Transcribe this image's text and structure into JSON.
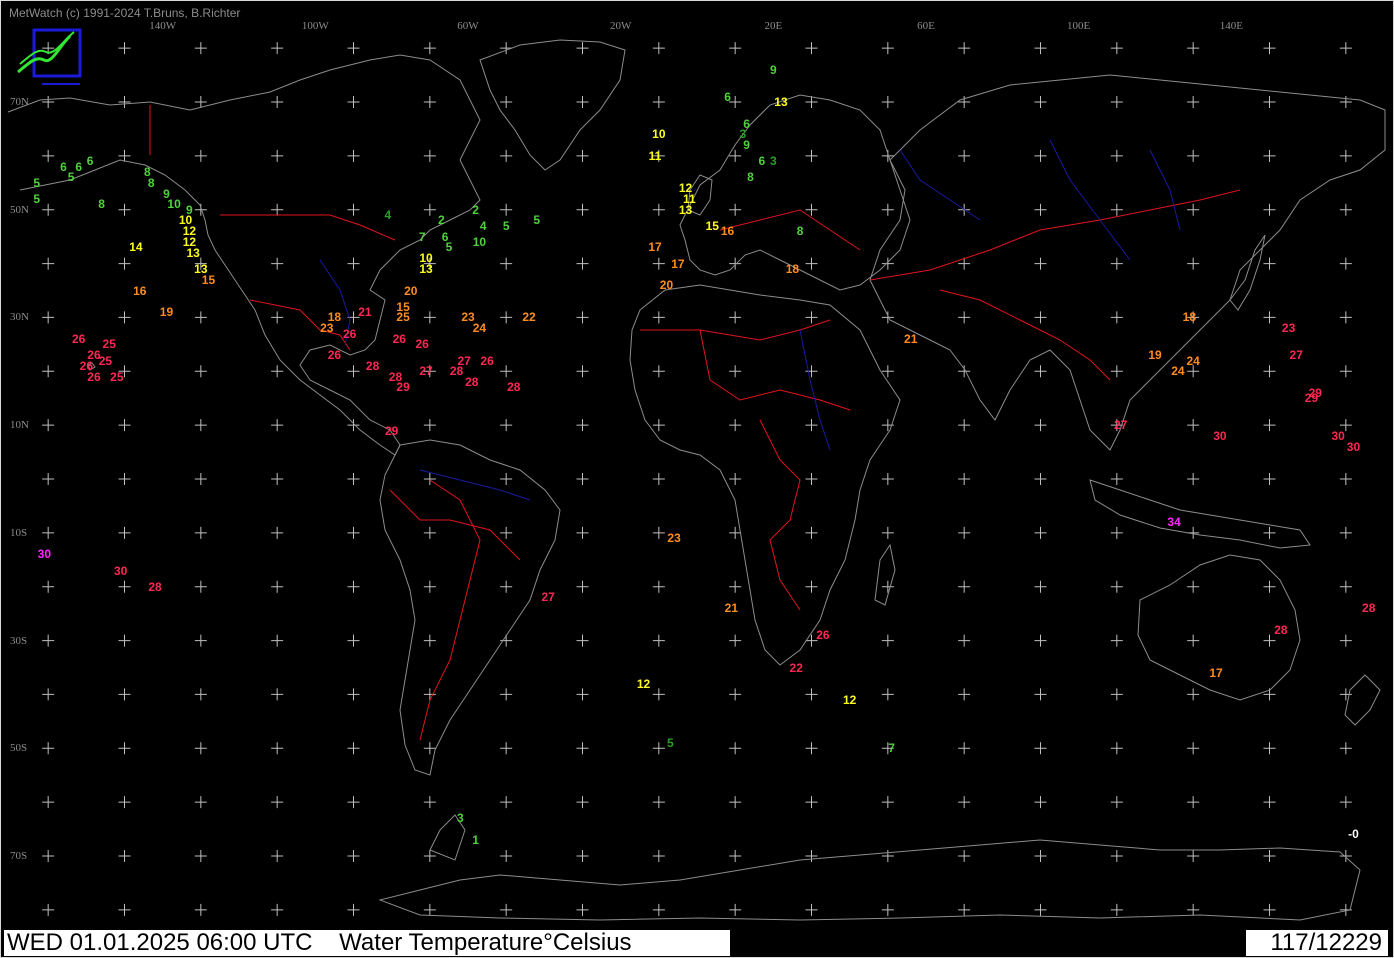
{
  "header": {
    "copyright": "MetWatch  (c) 1991-2024 T.Bruns, B.Richter"
  },
  "footer": {
    "datetime": "WED 01.01.2025 06:00 UTC",
    "title": "Water Temperature°Celsius",
    "count": "117/12229"
  },
  "colors": {
    "background": "#000000",
    "coastline": "#8c8c8c",
    "borders": "#e0141e",
    "rivers": "#1a1aa0",
    "grid": "#bfbfbf",
    "green": "#50d23c",
    "dark_green": "#2aa02a",
    "yellow": "#ffff1e",
    "orange": "#ff8c1e",
    "red": "#ff2850",
    "magenta": "#ff28ff",
    "white": "#ffffff"
  },
  "axes": {
    "lon_labels": [
      {
        "text": "140W",
        "lon": -140
      },
      {
        "text": "100W",
        "lon": -100
      },
      {
        "text": "60W",
        "lon": -60
      },
      {
        "text": "20W",
        "lon": -20
      },
      {
        "text": "20E",
        "lon": 20
      },
      {
        "text": "60E",
        "lon": 60
      },
      {
        "text": "100E",
        "lon": 100
      },
      {
        "text": "140E",
        "lon": 140
      }
    ],
    "lat_labels": [
      {
        "text": "70N",
        "lat": 70
      },
      {
        "text": "50N",
        "lat": 50
      },
      {
        "text": "30N",
        "lat": 30
      },
      {
        "text": "10N",
        "lat": 10
      },
      {
        "text": "10S",
        "lat": -10
      },
      {
        "text": "30S",
        "lat": -30
      },
      {
        "text": "50S",
        "lat": -50
      },
      {
        "text": "70S",
        "lat": -70
      }
    ],
    "lon_range": [
      -180,
      180
    ],
    "lat_range": [
      85,
      -90
    ],
    "grid_step_lon": 10,
    "grid_step_lat": 10
  },
  "observations": [
    {
      "v": "5",
      "lon": -173,
      "lat": 55,
      "c": "green"
    },
    {
      "v": "5",
      "lon": -173,
      "lat": 52,
      "c": "green"
    },
    {
      "v": "6",
      "lon": -166,
      "lat": 58,
      "c": "green"
    },
    {
      "v": "6",
      "lon": -162,
      "lat": 58,
      "c": "green"
    },
    {
      "v": "6",
      "lon": -159,
      "lat": 59,
      "c": "green"
    },
    {
      "v": "5",
      "lon": -164,
      "lat": 56,
      "c": "green"
    },
    {
      "v": "8",
      "lon": -156,
      "lat": 51,
      "c": "green"
    },
    {
      "v": "8",
      "lon": -144,
      "lat": 57,
      "c": "green"
    },
    {
      "v": "8",
      "lon": -143,
      "lat": 55,
      "c": "green"
    },
    {
      "v": "9",
      "lon": -139,
      "lat": 53,
      "c": "green"
    },
    {
      "v": "10",
      "lon": -137,
      "lat": 51,
      "c": "green"
    },
    {
      "v": "9",
      "lon": -133,
      "lat": 50,
      "c": "green"
    },
    {
      "v": "10",
      "lon": -134,
      "lat": 48,
      "c": "yellow"
    },
    {
      "v": "12",
      "lon": -133,
      "lat": 46,
      "c": "yellow"
    },
    {
      "v": "12",
      "lon": -133,
      "lat": 44,
      "c": "yellow"
    },
    {
      "v": "14",
      "lon": -147,
      "lat": 43,
      "c": "yellow"
    },
    {
      "v": "13",
      "lon": -132,
      "lat": 42,
      "c": "yellow"
    },
    {
      "v": "13",
      "lon": -130,
      "lat": 39,
      "c": "yellow"
    },
    {
      "v": "15",
      "lon": -128,
      "lat": 37,
      "c": "orange"
    },
    {
      "v": "16",
      "lon": -146,
      "lat": 35,
      "c": "orange"
    },
    {
      "v": "19",
      "lon": -139,
      "lat": 31,
      "c": "orange"
    },
    {
      "v": "4",
      "lon": -81,
      "lat": 49,
      "c": "dark_green"
    },
    {
      "v": "2",
      "lon": -67,
      "lat": 48,
      "c": "green"
    },
    {
      "v": "2",
      "lon": -58,
      "lat": 50,
      "c": "green"
    },
    {
      "v": "4",
      "lon": -56,
      "lat": 47,
      "c": "green"
    },
    {
      "v": "5",
      "lon": -50,
      "lat": 47,
      "c": "green"
    },
    {
      "v": "5",
      "lon": -42,
      "lat": 48,
      "c": "green"
    },
    {
      "v": "7",
      "lon": -72,
      "lat": 45,
      "c": "green"
    },
    {
      "v": "6",
      "lon": -66,
      "lat": 45,
      "c": "green"
    },
    {
      "v": "5",
      "lon": -65,
      "lat": 43,
      "c": "green"
    },
    {
      "v": "10",
      "lon": -57,
      "lat": 44,
      "c": "green"
    },
    {
      "v": "10",
      "lon": -71,
      "lat": 41,
      "c": "yellow"
    },
    {
      "v": "13",
      "lon": -71,
      "lat": 39,
      "c": "yellow"
    },
    {
      "v": "20",
      "lon": -75,
      "lat": 35,
      "c": "orange"
    },
    {
      "v": "15",
      "lon": -77,
      "lat": 32,
      "c": "orange"
    },
    {
      "v": "25",
      "lon": -77,
      "lat": 30,
      "c": "orange"
    },
    {
      "v": "18",
      "lon": -95,
      "lat": 30,
      "c": "orange"
    },
    {
      "v": "21",
      "lon": -87,
      "lat": 31,
      "c": "red"
    },
    {
      "v": "23",
      "lon": -97,
      "lat": 28,
      "c": "orange"
    },
    {
      "v": "26",
      "lon": -91,
      "lat": 27,
      "c": "red"
    },
    {
      "v": "26",
      "lon": -78,
      "lat": 26,
      "c": "red"
    },
    {
      "v": "23",
      "lon": -60,
      "lat": 30,
      "c": "orange"
    },
    {
      "v": "24",
      "lon": -57,
      "lat": 28,
      "c": "orange"
    },
    {
      "v": "22",
      "lon": -44,
      "lat": 30,
      "c": "orange"
    },
    {
      "v": "26",
      "lon": -95,
      "lat": 23,
      "c": "red"
    },
    {
      "v": "26",
      "lon": -72,
      "lat": 25,
      "c": "red"
    },
    {
      "v": "28",
      "lon": -85,
      "lat": 21,
      "c": "red"
    },
    {
      "v": "27",
      "lon": -61,
      "lat": 22,
      "c": "red"
    },
    {
      "v": "26",
      "lon": -55,
      "lat": 22,
      "c": "red"
    },
    {
      "v": "28",
      "lon": -79,
      "lat": 19,
      "c": "red"
    },
    {
      "v": "27",
      "lon": -71,
      "lat": 20,
      "c": "red"
    },
    {
      "v": "28",
      "lon": -63,
      "lat": 20,
      "c": "red"
    },
    {
      "v": "28",
      "lon": -59,
      "lat": 18,
      "c": "red"
    },
    {
      "v": "29",
      "lon": -77,
      "lat": 17,
      "c": "red"
    },
    {
      "v": "28",
      "lon": -48,
      "lat": 17,
      "c": "red"
    },
    {
      "v": "29",
      "lon": -80,
      "lat": 9,
      "c": "red"
    },
    {
      "v": "26",
      "lon": -162,
      "lat": 26,
      "c": "red"
    },
    {
      "v": "26",
      "lon": -158,
      "lat": 23,
      "c": "red"
    },
    {
      "v": "25",
      "lon": -154,
      "lat": 25,
      "c": "red"
    },
    {
      "v": "25",
      "lon": -155,
      "lat": 22,
      "c": "red"
    },
    {
      "v": "26",
      "lon": -160,
      "lat": 21,
      "c": "red"
    },
    {
      "v": "26",
      "lon": -158,
      "lat": 19,
      "c": "red"
    },
    {
      "v": "25",
      "lon": -152,
      "lat": 19,
      "c": "red"
    },
    {
      "v": "30",
      "lon": -171,
      "lat": -14,
      "c": "magenta"
    },
    {
      "v": "30",
      "lon": -151,
      "lat": -17,
      "c": "red"
    },
    {
      "v": "28",
      "lon": -142,
      "lat": -20,
      "c": "red"
    },
    {
      "v": "9",
      "lon": 20,
      "lat": 76,
      "c": "green"
    },
    {
      "v": "6",
      "lon": 8,
      "lat": 71,
      "c": "green"
    },
    {
      "v": "13",
      "lon": 22,
      "lat": 70,
      "c": "yellow"
    },
    {
      "v": "6",
      "lon": 13,
      "lat": 66,
      "c": "green"
    },
    {
      "v": "3",
      "lon": 12,
      "lat": 64,
      "c": "dark_green"
    },
    {
      "v": "9",
      "lon": 13,
      "lat": 62,
      "c": "green"
    },
    {
      "v": "6",
      "lon": 17,
      "lat": 59,
      "c": "green"
    },
    {
      "v": "3",
      "lon": 20,
      "lat": 59,
      "c": "dark_green"
    },
    {
      "v": "8",
      "lon": 14,
      "lat": 56,
      "c": "green"
    },
    {
      "v": "10",
      "lon": -10,
      "lat": 64,
      "c": "yellow"
    },
    {
      "v": "11",
      "lon": -11,
      "lat": 60,
      "c": "yellow"
    },
    {
      "v": "12",
      "lon": -3,
      "lat": 54,
      "c": "yellow"
    },
    {
      "v": "11",
      "lon": -2,
      "lat": 52,
      "c": "yellow"
    },
    {
      "v": "13",
      "lon": -3,
      "lat": 50,
      "c": "yellow"
    },
    {
      "v": "15",
      "lon": 4,
      "lat": 47,
      "c": "yellow"
    },
    {
      "v": "16",
      "lon": 8,
      "lat": 46,
      "c": "orange"
    },
    {
      "v": "8",
      "lon": 27,
      "lat": 46,
      "c": "green"
    },
    {
      "v": "17",
      "lon": -11,
      "lat": 43,
      "c": "orange"
    },
    {
      "v": "17",
      "lon": -5,
      "lat": 40,
      "c": "orange"
    },
    {
      "v": "18",
      "lon": 25,
      "lat": 39,
      "c": "orange"
    },
    {
      "v": "20",
      "lon": -8,
      "lat": 36,
      "c": "orange"
    },
    {
      "v": "21",
      "lon": 56,
      "lat": 26,
      "c": "orange"
    },
    {
      "v": "23",
      "lon": -6,
      "lat": -11,
      "c": "orange"
    },
    {
      "v": "21",
      "lon": 9,
      "lat": -24,
      "c": "orange"
    },
    {
      "v": "26",
      "lon": 33,
      "lat": -29,
      "c": "red"
    },
    {
      "v": "22",
      "lon": 26,
      "lat": -35,
      "c": "red"
    },
    {
      "v": "27",
      "lon": -39,
      "lat": -22,
      "c": "red"
    },
    {
      "v": "18",
      "lon": 129,
      "lat": 30,
      "c": "orange"
    },
    {
      "v": "23",
      "lon": 155,
      "lat": 28,
      "c": "red"
    },
    {
      "v": "19",
      "lon": 120,
      "lat": 23,
      "c": "orange"
    },
    {
      "v": "24",
      "lon": 130,
      "lat": 22,
      "c": "orange"
    },
    {
      "v": "27",
      "lon": 157,
      "lat": 23,
      "c": "red"
    },
    {
      "v": "24",
      "lon": 126,
      "lat": 20,
      "c": "orange"
    },
    {
      "v": "29",
      "lon": 162,
      "lat": 16,
      "c": "red"
    },
    {
      "v": "29",
      "lon": 161,
      "lat": 15,
      "c": "red"
    },
    {
      "v": "27",
      "lon": 111,
      "lat": 10,
      "c": "red"
    },
    {
      "v": "30",
      "lon": 137,
      "lat": 8,
      "c": "red"
    },
    {
      "v": "30",
      "lon": 168,
      "lat": 8,
      "c": "red"
    },
    {
      "v": "30",
      "lon": 172,
      "lat": 6,
      "c": "red"
    },
    {
      "v": "34",
      "lon": 125,
      "lat": -8,
      "c": "magenta"
    },
    {
      "v": "28",
      "lon": 176,
      "lat": -24,
      "c": "red"
    },
    {
      "v": "28",
      "lon": 153,
      "lat": -28,
      "c": "red"
    },
    {
      "v": "17",
      "lon": 136,
      "lat": -36,
      "c": "orange"
    },
    {
      "v": "12",
      "lon": -14,
      "lat": -38,
      "c": "yellow"
    },
    {
      "v": "12",
      "lon": 40,
      "lat": -41,
      "c": "yellow"
    },
    {
      "v": "5",
      "lon": -7,
      "lat": -49,
      "c": "dark_green"
    },
    {
      "v": "7",
      "lon": 51,
      "lat": -50,
      "c": "green"
    },
    {
      "v": "3",
      "lon": -62,
      "lat": -63,
      "c": "green"
    },
    {
      "v": "1",
      "lon": -58,
      "lat": -67,
      "c": "green"
    },
    {
      "v": "-0",
      "lon": 172,
      "lat": -66,
      "c": "white"
    }
  ]
}
